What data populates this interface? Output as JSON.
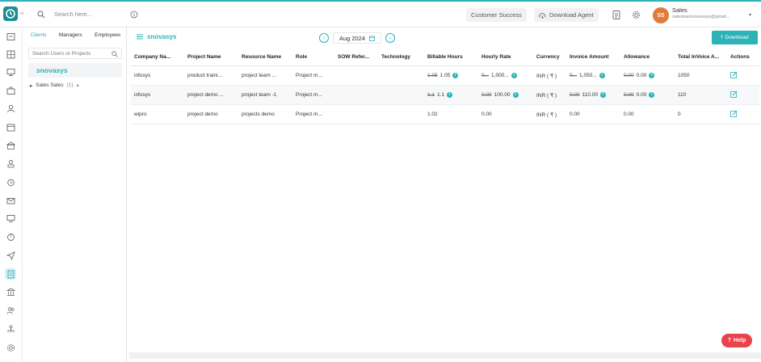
{
  "topbar": {
    "logo_side": "ııı",
    "search_placeholder": "Search here...",
    "customer_success": "Customer Success",
    "download_agent": "Download Agent",
    "avatar_initials": "SS",
    "user_name": "Sales",
    "user_email": "salesteamsnovasys@gmail..."
  },
  "panel": {
    "tabs": [
      "Clients",
      "Managers",
      "Employees"
    ],
    "search_placeholder": "Search Users or Projects",
    "selected_client": "snovasys",
    "tree_item": {
      "label": "Sales Sales",
      "count": "(1)"
    }
  },
  "main": {
    "breadcrumb": "snovasys",
    "month": "Aug 2024",
    "download_label": "Download"
  },
  "table": {
    "columns": [
      "Company Na...",
      "Project Name",
      "Resource Name",
      "Role",
      "SOW Refer...",
      "Technology",
      "Billable Hours",
      "Hourly Rate",
      "Currency",
      "Invoice Amount",
      "Allowance",
      "Total InVoice A...",
      "Actions"
    ],
    "rows": [
      {
        "company": "infosys",
        "project": "product traini...",
        "resource": "project team ...",
        "role": "Project m...",
        "sow": "",
        "technology": "",
        "billable_old": "1.05",
        "billable": "1.05",
        "rate_old": "0...",
        "rate": "1,000...",
        "currency": "INR ( ₹ )",
        "invoice_old": "0...",
        "invoice": "1,050...",
        "allowance_old": "0.00",
        "allowance": "0.00",
        "total": "1050"
      },
      {
        "company": "infosys",
        "project": "project demo ...",
        "resource": "project team -1",
        "role": "Project m...",
        "sow": "",
        "technology": "",
        "billable_old": "1.1",
        "billable": "1.1",
        "rate_old": "0.00",
        "rate": "100.00",
        "currency": "INR ( ₹ )",
        "invoice_old": "0.00",
        "invoice": "110.00",
        "allowance_old": "0.00",
        "allowance": "0.00",
        "total": "110"
      },
      {
        "company": "wipro",
        "project": "project demo",
        "resource": "projects demo",
        "role": "Project m...",
        "sow": "",
        "technology": "",
        "billable_old": "",
        "billable": "1.02",
        "rate_old": "",
        "rate": "0.00",
        "currency": "INR ( ₹ )",
        "invoice_old": "",
        "invoice": "0.00",
        "allowance_old": "",
        "allowance": "0.00",
        "total": "0"
      }
    ]
  },
  "help_label": "Help",
  "colors": {
    "accent": "#2bb3b8",
    "avatar": "#e07b39",
    "help": "#e8434a"
  }
}
